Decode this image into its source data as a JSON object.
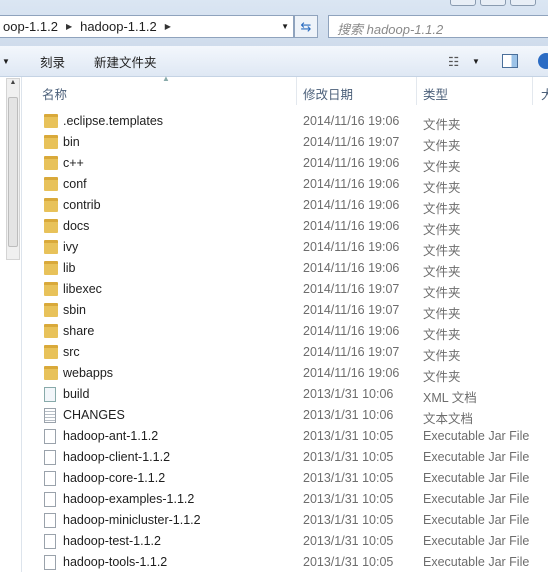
{
  "address": {
    "crumbs": [
      "oop-1.1.2",
      "hadoop-1.1.2"
    ]
  },
  "search": {
    "placeholder": "搜索 hadoop-1.1.2"
  },
  "toolbar": {
    "burn": "刻录",
    "new_folder": "新建文件夹"
  },
  "columns": {
    "name": "名称",
    "date": "修改日期",
    "type": "类型",
    "size": "大"
  },
  "files": [
    {
      "name": ".eclipse.templates",
      "date": "2014/11/16 19:06",
      "type": "文件夹",
      "icon": "folder"
    },
    {
      "name": "bin",
      "date": "2014/11/16 19:07",
      "type": "文件夹",
      "icon": "folder"
    },
    {
      "name": "c++",
      "date": "2014/11/16 19:06",
      "type": "文件夹",
      "icon": "folder"
    },
    {
      "name": "conf",
      "date": "2014/11/16 19:06",
      "type": "文件夹",
      "icon": "folder"
    },
    {
      "name": "contrib",
      "date": "2014/11/16 19:06",
      "type": "文件夹",
      "icon": "folder"
    },
    {
      "name": "docs",
      "date": "2014/11/16 19:06",
      "type": "文件夹",
      "icon": "folder"
    },
    {
      "name": "ivy",
      "date": "2014/11/16 19:06",
      "type": "文件夹",
      "icon": "folder"
    },
    {
      "name": "lib",
      "date": "2014/11/16 19:06",
      "type": "文件夹",
      "icon": "folder"
    },
    {
      "name": "libexec",
      "date": "2014/11/16 19:07",
      "type": "文件夹",
      "icon": "folder"
    },
    {
      "name": "sbin",
      "date": "2014/11/16 19:07",
      "type": "文件夹",
      "icon": "folder"
    },
    {
      "name": "share",
      "date": "2014/11/16 19:06",
      "type": "文件夹",
      "icon": "folder"
    },
    {
      "name": "src",
      "date": "2014/11/16 19:07",
      "type": "文件夹",
      "icon": "folder"
    },
    {
      "name": "webapps",
      "date": "2014/11/16 19:06",
      "type": "文件夹",
      "icon": "folder"
    },
    {
      "name": "build",
      "date": "2013/1/31 10:06",
      "type": "XML 文档",
      "icon": "xml"
    },
    {
      "name": "CHANGES",
      "date": "2013/1/31 10:06",
      "type": "文本文档",
      "icon": "txt"
    },
    {
      "name": "hadoop-ant-1.1.2",
      "date": "2013/1/31 10:05",
      "type": "Executable Jar File",
      "icon": "file"
    },
    {
      "name": "hadoop-client-1.1.2",
      "date": "2013/1/31 10:05",
      "type": "Executable Jar File",
      "icon": "file"
    },
    {
      "name": "hadoop-core-1.1.2",
      "date": "2013/1/31 10:05",
      "type": "Executable Jar File",
      "icon": "file"
    },
    {
      "name": "hadoop-examples-1.1.2",
      "date": "2013/1/31 10:05",
      "type": "Executable Jar File",
      "icon": "file"
    },
    {
      "name": "hadoop-minicluster-1.1.2",
      "date": "2013/1/31 10:05",
      "type": "Executable Jar File",
      "icon": "file"
    },
    {
      "name": "hadoop-test-1.1.2",
      "date": "2013/1/31 10:05",
      "type": "Executable Jar File",
      "icon": "file"
    },
    {
      "name": "hadoop-tools-1.1.2",
      "date": "2013/1/31 10:05",
      "type": "Executable Jar File",
      "icon": "file"
    }
  ]
}
